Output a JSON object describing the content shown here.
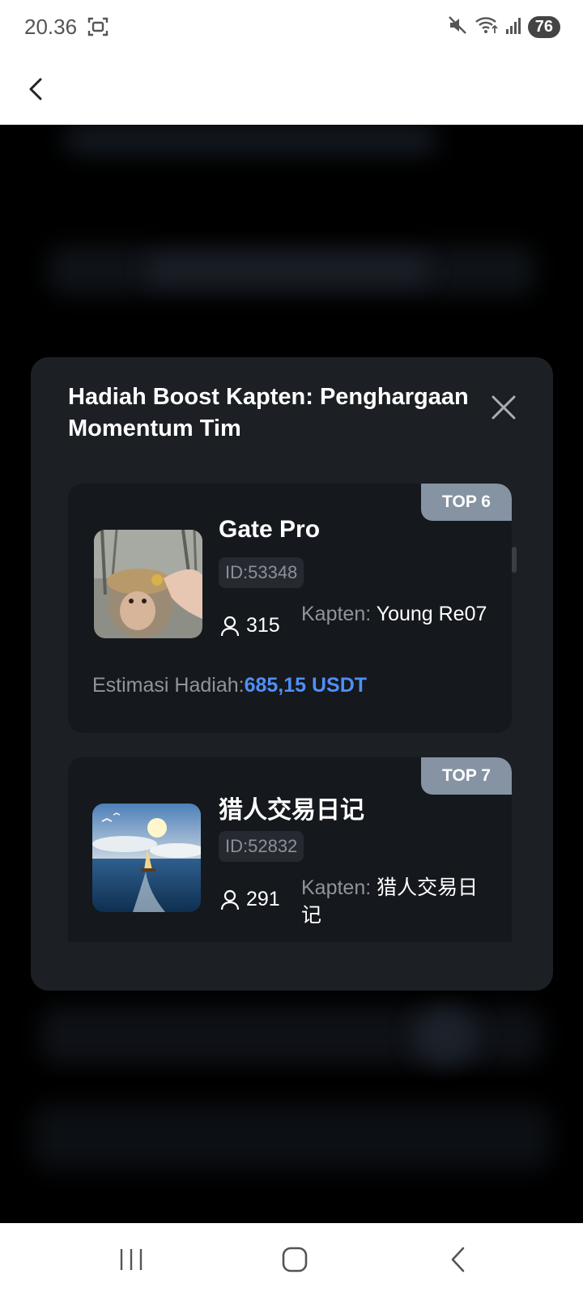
{
  "status_bar": {
    "time": "20.36",
    "battery": "76",
    "icons": [
      "screenshot-icon",
      "mute-icon",
      "wifi-icon",
      "signal-icon"
    ]
  },
  "header": {
    "back_icon": "chevron-left-icon"
  },
  "modal": {
    "title": "Hadiah Boost Kapten: Penghargaan Momentum Tim",
    "close_icon": "close-icon",
    "teams": [
      {
        "rank": "TOP 6",
        "name": "Gate Pro",
        "id": "ID:53348",
        "members": "315",
        "captain_label": "Kapten:",
        "captain_name": "Young Re07",
        "reward_label": "Estimasi Hadiah:",
        "reward_value": "685,15 USDT",
        "avatar": "monkey-photo"
      },
      {
        "rank": "TOP 7",
        "name": "猎人交易日记",
        "id": "ID:52832",
        "members": "291",
        "captain_label": "Kapten:",
        "captain_name": "猎人交易日记",
        "avatar": "sailboat-photo"
      }
    ]
  },
  "colors": {
    "modal_bg": "#1c1f23",
    "card_bg": "#15181c",
    "badge_bg": "#8593a3",
    "accent": "#4f8ff7"
  },
  "nav_bar": {
    "icons": [
      "recent-apps-icon",
      "home-icon",
      "back-icon"
    ]
  }
}
